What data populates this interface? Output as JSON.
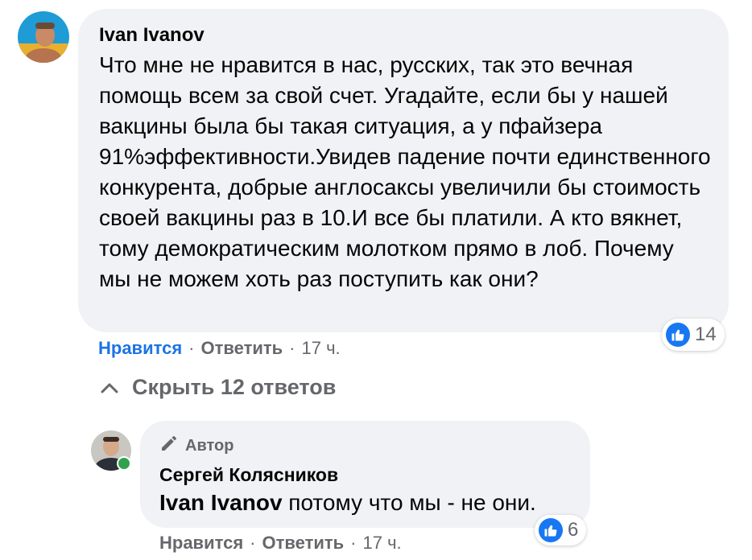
{
  "comment": {
    "author": "Ivan Ivanov",
    "text": "Что мне не нравится в нас, русских, так это вечная помощь всем за свой счет. Угадайте, если бы у нашей вакцины была бы такая ситуация, а у пфайзера 91%эффективности.Увидев падение почти единственного конкурента, добрые англосаксы увеличили бы стоимость своей вакцины раз в 10.И все бы платили. А кто вякнет, тому демократическим молотком прямо в лоб. Почему мы не можем хоть раз поступить как они?",
    "like_label": "Нравится",
    "reply_label": "Ответить",
    "separator": "·",
    "time": "17 ч.",
    "reaction_count": "14"
  },
  "hide_replies_label": "Скрыть 12 ответов",
  "reply": {
    "badge_label": "Автор",
    "author": "Сергей Колясников",
    "mention": "Ivan Ivanov",
    "text": "потому что мы - не они.",
    "like_label": "Нравится",
    "reply_label": "Ответить",
    "separator": "·",
    "time": "17 ч.",
    "reaction_count": "6"
  },
  "colors": {
    "bubble": "#f0f2f5",
    "link_blue": "#1b74e4",
    "like_badge": "#1877f2",
    "muted": "#65676b",
    "online": "#31a24c"
  },
  "icons": [
    "like-icon",
    "chevron-up-icon",
    "pencil-icon"
  ]
}
